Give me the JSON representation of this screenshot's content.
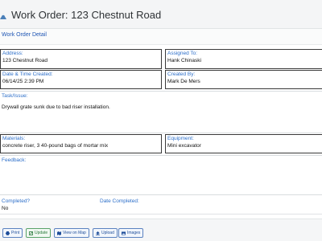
{
  "header": {
    "title": "Work Order: 123 Chestnut Road"
  },
  "nav": {
    "detail_link": "Work Order Detail"
  },
  "fields": {
    "address": {
      "label": "Address:",
      "value": "123 Chestnut Road"
    },
    "assigned_to": {
      "label": "Assigned To:",
      "value": "Hank Chinaski"
    },
    "date_created": {
      "label": "Date & Time Created:",
      "value": "06/14/25 2:39 PM"
    },
    "created_by": {
      "label": "Created By:",
      "value": "Mark De Mers"
    },
    "task_issue": {
      "label": "Task/Issue:",
      "value": "Drywall grate sunk due to bad riser installation."
    },
    "materials": {
      "label": "Materials:",
      "value": "concrete riser, 3 40-pound bags of mortar mix"
    },
    "equipment": {
      "label": "Equipment:",
      "value": "Mini excavator"
    },
    "feedback": {
      "label": "Feedback:",
      "value": ""
    },
    "completed": {
      "label": "Completed?",
      "value": "No"
    },
    "date_completed": {
      "label": "Date Completed:",
      "value": ""
    }
  },
  "buttons": {
    "print": "Print",
    "update": "Update",
    "view_on_map": "View on Map",
    "upload": "Upload",
    "images": "Images"
  },
  "colors": {
    "label_blue": "#2d6fc9",
    "button_blue": "#1f4e9a",
    "button_green": "#2a7a3b"
  }
}
